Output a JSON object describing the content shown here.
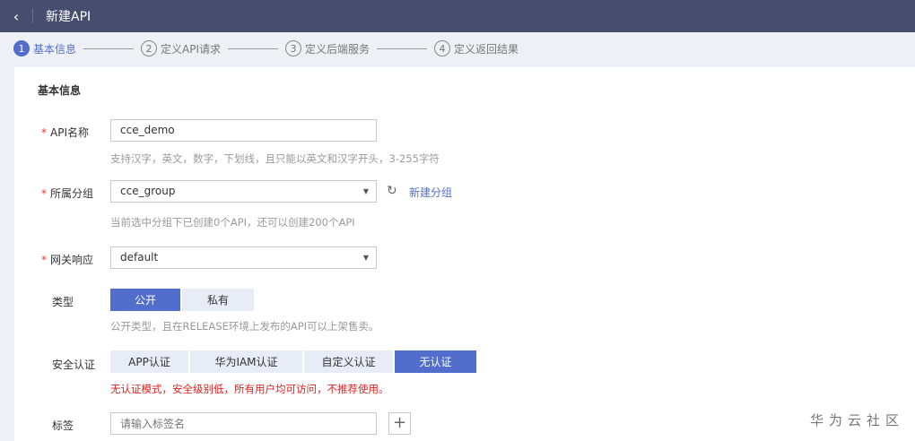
{
  "header": {
    "title": "新建API",
    "back_icon": "chevron-left-icon"
  },
  "steps": [
    {
      "num": "1",
      "label": "基本信息"
    },
    {
      "num": "2",
      "label": "定义API请求"
    },
    {
      "num": "3",
      "label": "定义后端服务"
    },
    {
      "num": "4",
      "label": "定义返回结果"
    }
  ],
  "section_title": "基本信息",
  "api_name": {
    "label": "API名称",
    "value": "cce_demo",
    "hint": "支持汉字，英文，数字，下划线，且只能以英文和汉字开头，3-255字符"
  },
  "group": {
    "label": "所属分组",
    "value": "cce_group",
    "new_group": "新建分组",
    "hint": "当前选中分组下已创建0个API，还可以创建200个API"
  },
  "gateway": {
    "label": "网关响应",
    "value": "default"
  },
  "type": {
    "label": "类型",
    "options": [
      "公开",
      "私有"
    ],
    "selected": "公开",
    "hint": "公开类型，且在RELEASE环境上发布的API可以上架售卖。"
  },
  "auth": {
    "label": "安全认证",
    "options": [
      "APP认证",
      "华为IAM认证",
      "自定义认证",
      "无认证"
    ],
    "selected": "无认证",
    "warning": "无认证模式，安全级别低，所有用户均可访问，不推荐使用。"
  },
  "tag": {
    "label": "标签",
    "placeholder": "请输入标签名"
  },
  "required_mark": "*",
  "watermark": "华为云社区"
}
